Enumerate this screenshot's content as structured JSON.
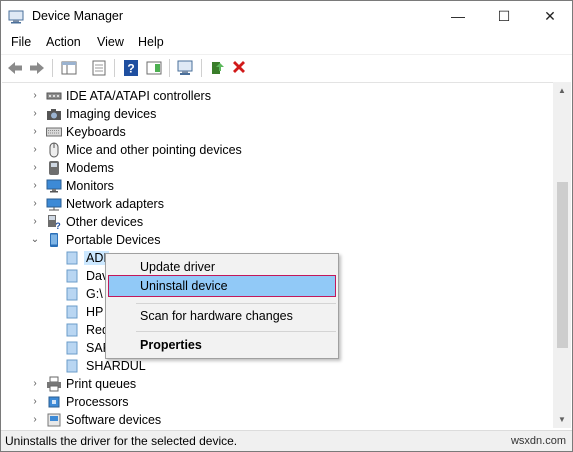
{
  "window": {
    "title": "Device Manager",
    "controls": {
      "minimize": "—",
      "maximize": "☐",
      "close": "✕"
    }
  },
  "menubar": {
    "items": [
      "File",
      "Action",
      "View",
      "Help"
    ]
  },
  "tree": {
    "items": [
      {
        "label": "IDE ATA/ATAPI controllers",
        "icon": "ide-controller-icon",
        "expander": "collapsed"
      },
      {
        "label": "Imaging devices",
        "icon": "camera-icon",
        "expander": "collapsed"
      },
      {
        "label": "Keyboards",
        "icon": "keyboard-icon",
        "expander": "collapsed"
      },
      {
        "label": "Mice and other pointing devices",
        "icon": "mouse-icon",
        "expander": "collapsed"
      },
      {
        "label": "Modems",
        "icon": "modem-icon",
        "expander": "collapsed"
      },
      {
        "label": "Monitors",
        "icon": "monitor-icon",
        "expander": "collapsed"
      },
      {
        "label": "Network adapters",
        "icon": "network-icon",
        "expander": "collapsed"
      },
      {
        "label": "Other devices",
        "icon": "unknown-device-icon",
        "expander": "collapsed"
      },
      {
        "label": "Portable Devices",
        "icon": "portable-device-icon",
        "expander": "expanded"
      },
      {
        "label": "ADI",
        "icon": "portable-device-icon",
        "child": true,
        "selected": true
      },
      {
        "label": "Dav",
        "icon": "portable-device-icon",
        "child": true
      },
      {
        "label": "G:\\",
        "icon": "portable-device-icon",
        "child": true
      },
      {
        "label": "HP",
        "icon": "portable-device-icon",
        "child": true
      },
      {
        "label": "Red",
        "icon": "portable-device-icon",
        "child": true
      },
      {
        "label": "SAR",
        "icon": "portable-device-icon",
        "child": true
      },
      {
        "label": "SHARDUL",
        "icon": "portable-device-icon",
        "child": true
      },
      {
        "label": "Print queues",
        "icon": "printer-icon",
        "expander": "collapsed"
      },
      {
        "label": "Processors",
        "icon": "processor-icon",
        "expander": "collapsed"
      },
      {
        "label": "Software devices",
        "icon": "software-device-icon",
        "expander": "collapsed"
      }
    ]
  },
  "context_menu": {
    "update_driver": "Update driver",
    "uninstall_device": "Uninstall device",
    "scan": "Scan for hardware changes",
    "properties": "Properties"
  },
  "statusbar": {
    "text": "Uninstalls the driver for the selected device.",
    "watermark": "wsxdn.com"
  },
  "colors": {
    "selection_highlight": "#91c9f7",
    "selection_border": "#c2185b",
    "uninstall_red": "#d11a1a",
    "help_blue": "#1f4fa0"
  }
}
